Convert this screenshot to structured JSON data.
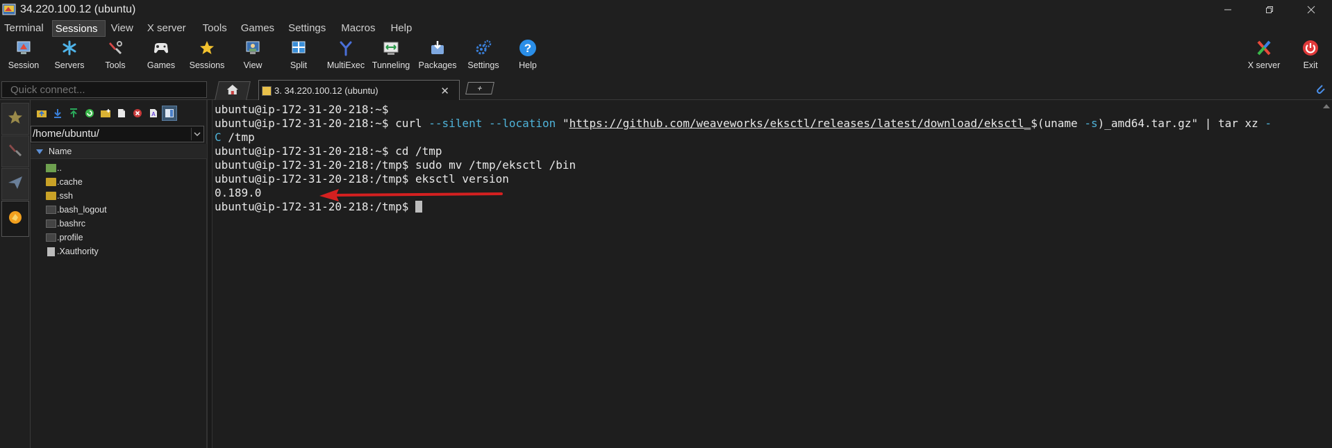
{
  "window": {
    "title": "34.220.100.12 (ubuntu)",
    "controls": [
      "minimize-icon",
      "restore-icon",
      "close-icon"
    ]
  },
  "menu": {
    "items": [
      "Terminal",
      "Sessions",
      "View",
      "X server",
      "Tools",
      "Games",
      "Settings",
      "Macros",
      "Help"
    ],
    "active": "Sessions"
  },
  "toolbar": {
    "buttons": [
      {
        "label": "Session",
        "icon": "session-icon"
      },
      {
        "label": "Servers",
        "icon": "servers-icon"
      },
      {
        "label": "Tools",
        "icon": "tools-icon"
      },
      {
        "label": "Games",
        "icon": "gamepad-icon"
      },
      {
        "label": "Sessions",
        "icon": "star-icon"
      },
      {
        "label": "View",
        "icon": "view-icon"
      },
      {
        "label": "Split",
        "icon": "split-icon"
      },
      {
        "label": "MultiExec",
        "icon": "multiexec-icon"
      },
      {
        "label": "Tunneling",
        "icon": "tunneling-icon"
      },
      {
        "label": "Packages",
        "icon": "packages-icon"
      },
      {
        "label": "Settings",
        "icon": "gears-icon"
      },
      {
        "label": "Help",
        "icon": "help-icon"
      }
    ],
    "right_buttons": [
      {
        "label": "X server",
        "icon": "xserver-icon"
      },
      {
        "label": "Exit",
        "icon": "power-icon"
      }
    ]
  },
  "quick_connect": {
    "placeholder": "Quick connect..."
  },
  "tabs": {
    "session_tab_label": "3. 34.220.100.12 (ubuntu)",
    "add_tab_label": "+"
  },
  "sftp": {
    "path": "/home/ubuntu/",
    "column_header": "Name",
    "files": [
      {
        "name": "..",
        "type": "folder-up"
      },
      {
        "name": ".cache",
        "type": "folder"
      },
      {
        "name": ".ssh",
        "type": "folder"
      },
      {
        "name": ".bash_logout",
        "type": "dotfile"
      },
      {
        "name": ".bashrc",
        "type": "dotfile"
      },
      {
        "name": ".profile",
        "type": "dotfile"
      },
      {
        "name": ".Xauthority",
        "type": "doc"
      }
    ]
  },
  "terminal": {
    "prompt_home": "ubuntu@ip-172-31-20-218:~$",
    "prompt_tmp": "ubuntu@ip-172-31-20-218:/tmp$",
    "cmd_curl": "curl",
    "flag_silent": "--silent",
    "flag_location": "--location",
    "quote_open": "\"",
    "url": "https://github.com/weaveworks/eksctl/releases/latest/download/eksctl_",
    "url_tail": "$(uname ",
    "flag_s": "-s",
    "url_end": ")_amd64.tar.gz\" | tar xz ",
    "flag_dash": "-",
    "flag_C": "C",
    "wrap_tail": " /tmp",
    "cmd_cd": "cd /tmp",
    "cmd_mv": "sudo mv /tmp/eksctl /bin",
    "cmd_version": "eksctl version",
    "output_version": "0.189.0",
    "annotation_color": "#d42020"
  }
}
